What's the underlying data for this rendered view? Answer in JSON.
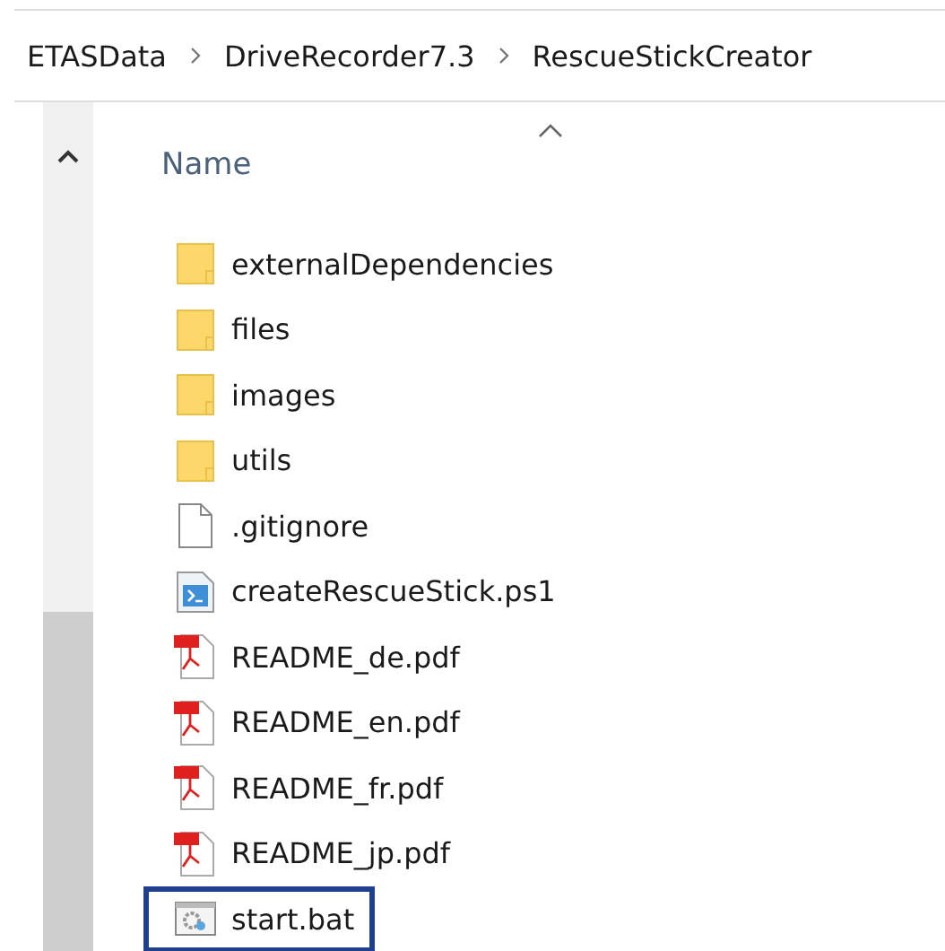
{
  "breadcrumb": [
    "ETASData",
    "DriveRecorder7.3",
    "RescueStickCreator"
  ],
  "column_header": {
    "label": "Name",
    "sort_ascending": true
  },
  "files": [
    {
      "name": "externalDependencies",
      "kind": "folder",
      "highlighted": false
    },
    {
      "name": "files",
      "kind": "folder",
      "highlighted": false
    },
    {
      "name": "images",
      "kind": "folder",
      "highlighted": false
    },
    {
      "name": "utils",
      "kind": "folder",
      "highlighted": false
    },
    {
      "name": ".gitignore",
      "kind": "file",
      "highlighted": false
    },
    {
      "name": "createRescueStick.ps1",
      "kind": "script",
      "highlighted": false
    },
    {
      "name": "README_de.pdf",
      "kind": "pdf",
      "highlighted": false
    },
    {
      "name": "README_en.pdf",
      "kind": "pdf",
      "highlighted": false
    },
    {
      "name": "README_fr.pdf",
      "kind": "pdf",
      "highlighted": false
    },
    {
      "name": "README_jp.pdf",
      "kind": "pdf",
      "highlighted": false
    },
    {
      "name": "start.bat",
      "kind": "batch",
      "highlighted": true
    }
  ]
}
